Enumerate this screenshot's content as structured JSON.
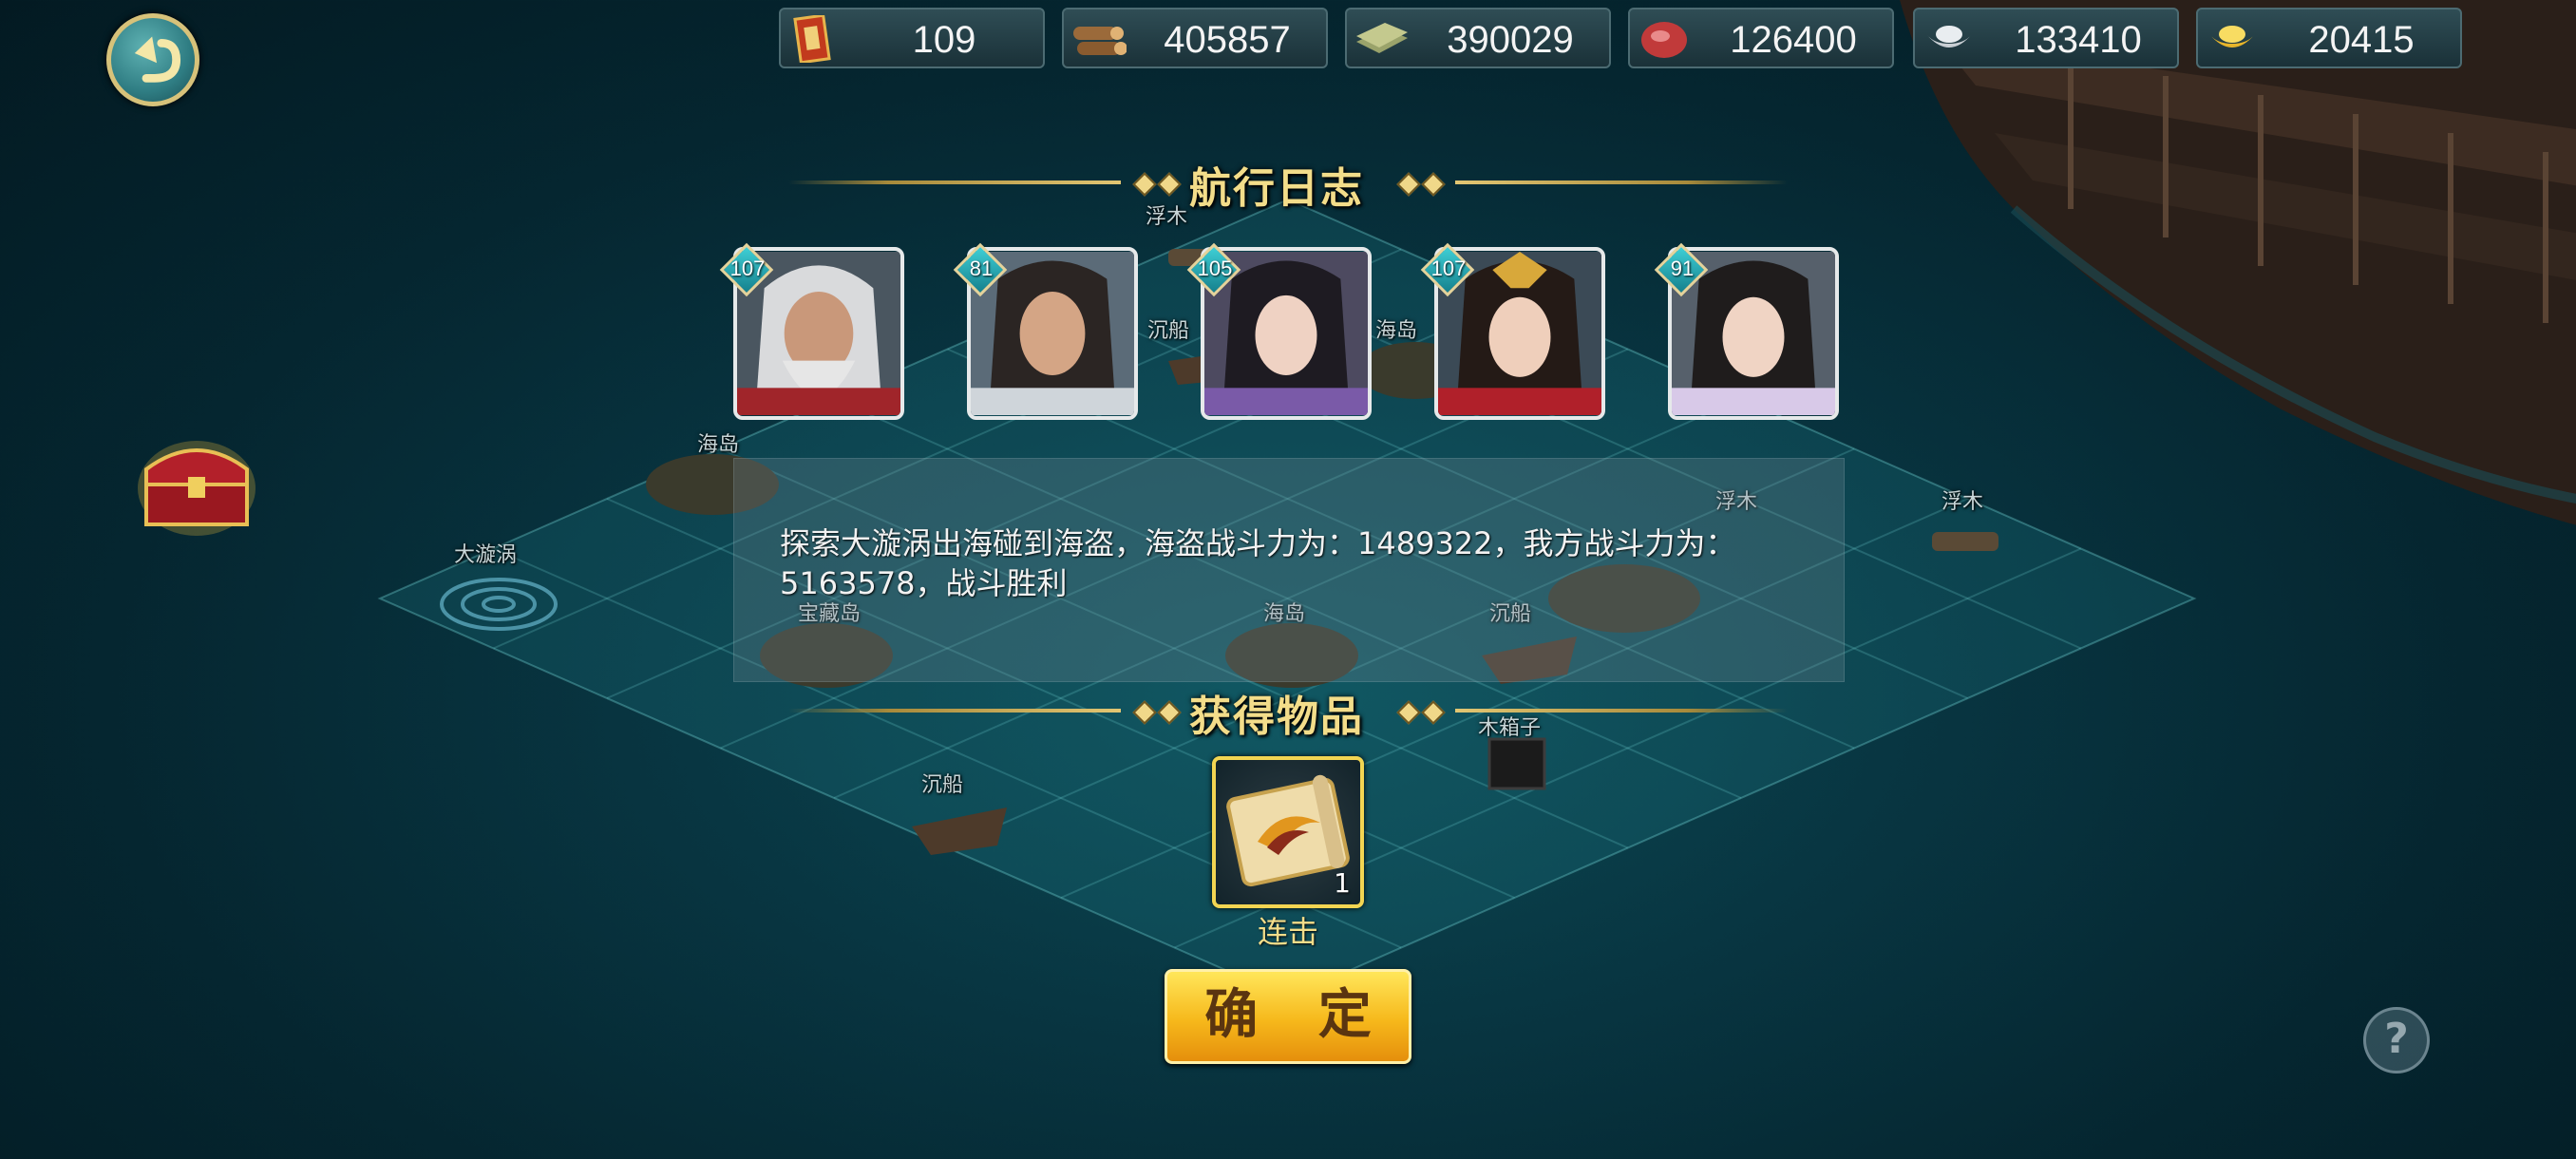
{
  "resources": [
    {
      "icon": "token-icon",
      "value": "109"
    },
    {
      "icon": "wood-icon",
      "value": "405857"
    },
    {
      "icon": "cash-icon",
      "value": "390029"
    },
    {
      "icon": "meat-icon",
      "value": "126400"
    },
    {
      "icon": "silver-icon",
      "value": "133410"
    },
    {
      "icon": "gold-icon",
      "value": "20415"
    }
  ],
  "log": {
    "title": "航行日志",
    "heroes": [
      {
        "level": "107"
      },
      {
        "level": "81"
      },
      {
        "level": "105"
      },
      {
        "level": "107"
      },
      {
        "level": "91"
      }
    ],
    "message": "探索大漩涡出海碰到海盗，海盗战斗力为：1489322，我方战斗力为：5163578，战斗胜利"
  },
  "rewards": {
    "title": "获得物品",
    "item": {
      "name": "连击",
      "quantity": "1",
      "icon": "scroll-icon"
    }
  },
  "confirm_label": "确 定",
  "help_label": "?",
  "map_labels": [
    "浮木",
    "沉船",
    "海岛",
    "海岛",
    "大漩涡",
    "宝藏岛",
    "海岛",
    "沉船",
    "浮木",
    "浮木",
    "沉船",
    "木箱子"
  ]
}
